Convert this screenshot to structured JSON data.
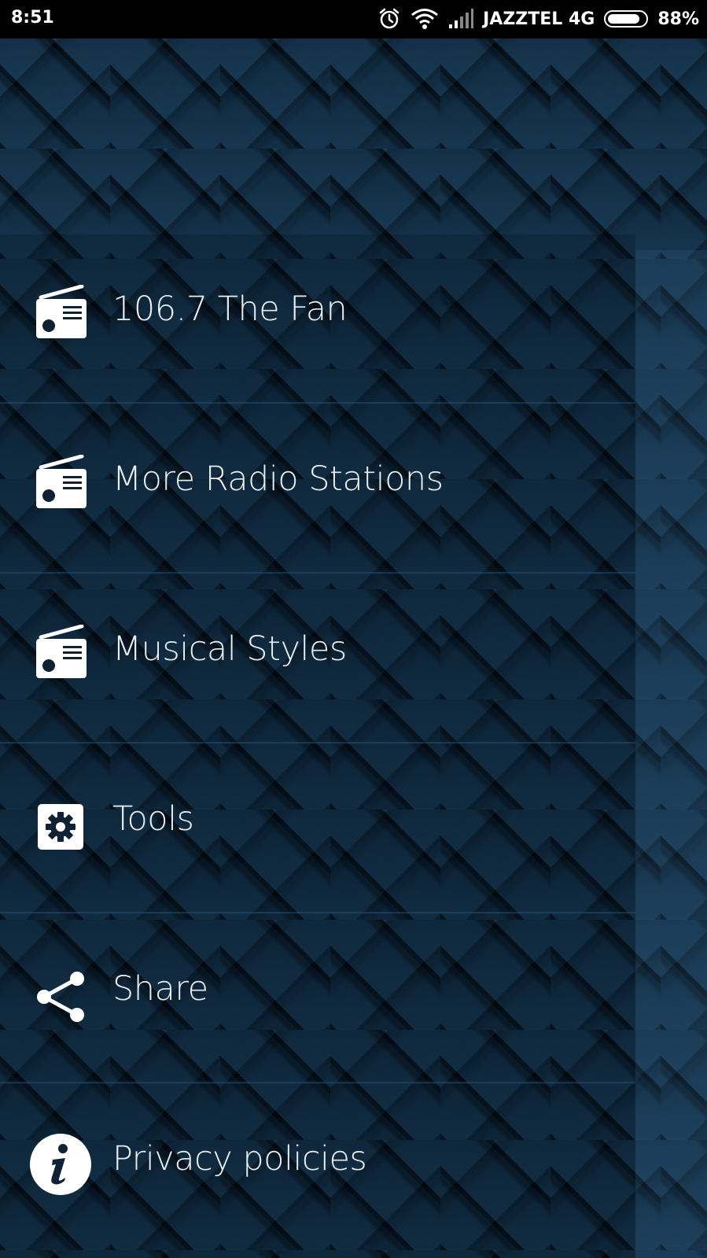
{
  "status_bar": {
    "time": "8:51",
    "carrier": "JAZZTEL 4G",
    "battery_percent": "88%",
    "battery_level": 0.88,
    "icons": [
      "alarm-icon",
      "wifi-icon",
      "signal-icon",
      "battery-icon"
    ]
  },
  "menu": {
    "items": [
      {
        "label": "106.7 The Fan",
        "icon": "radio-icon"
      },
      {
        "label": "More Radio Stations",
        "icon": "radio-icon"
      },
      {
        "label": "Musical Styles",
        "icon": "radio-icon"
      },
      {
        "label": "Tools",
        "icon": "gear-icon"
      },
      {
        "label": "Share",
        "icon": "share-icon"
      },
      {
        "label": "Privacy policies",
        "icon": "info-icon"
      }
    ]
  },
  "colors": {
    "text": "#e9eef2",
    "status_bar": "#000000",
    "background": "#0e2233",
    "icon": "#ffffff"
  }
}
